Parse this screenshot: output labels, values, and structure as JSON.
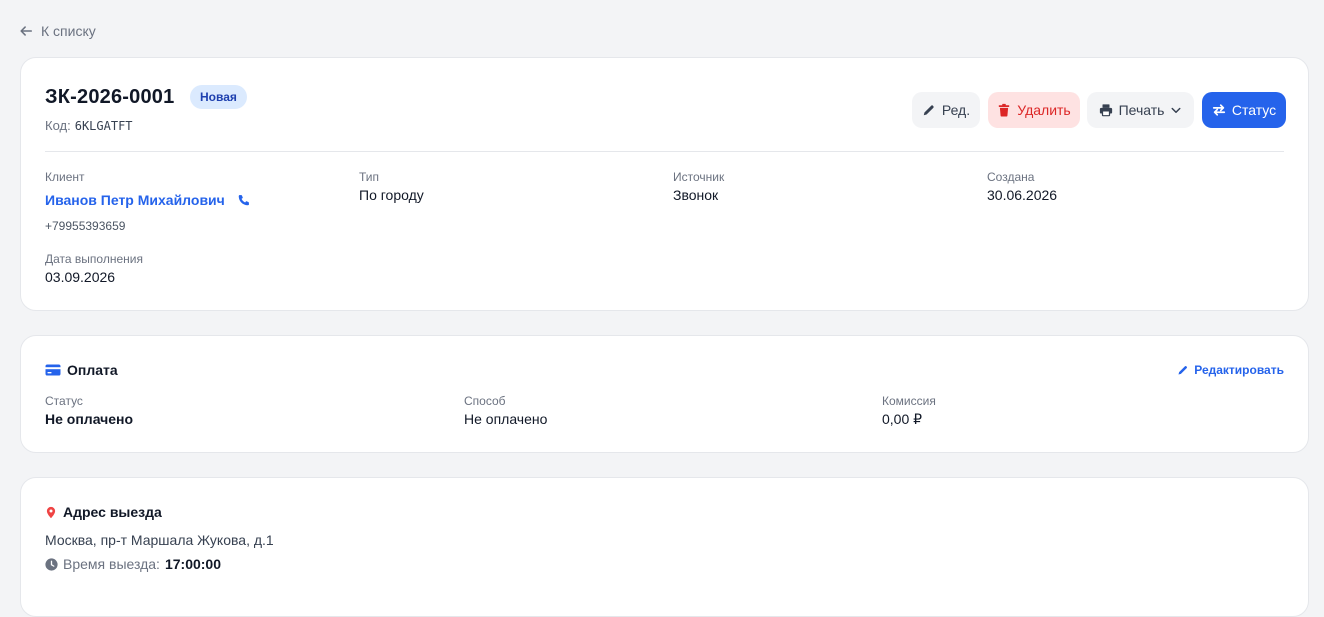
{
  "nav": {
    "back_label": "К списку"
  },
  "order": {
    "number": "ЗК-2026-0001",
    "status_badge": "Новая",
    "code_label": "Код:",
    "code_value": "6KLGATFT",
    "actions": {
      "edit": "Ред.",
      "delete": "Удалить",
      "print": "Печать",
      "status": "Статус"
    },
    "fields": {
      "client_label": "Клиент",
      "client_name": "Иванов Петр Михайлович",
      "client_phone": "+79955393659",
      "type_label": "Тип",
      "type_value": "По городу",
      "source_label": "Источник",
      "source_value": "Звонок",
      "created_label": "Создана",
      "created_value": "30.06.2026",
      "due_label": "Дата выполнения",
      "due_value": "03.09.2026"
    }
  },
  "payment": {
    "title": "Оплата",
    "edit_label": "Редактировать",
    "status_label": "Статус",
    "status_value": "Не оплачено",
    "method_label": "Способ",
    "method_value": "Не оплачено",
    "fee_label": "Комиссия",
    "fee_value": "0,00 ₽"
  },
  "address": {
    "title": "Адрес выезда",
    "value": "Москва, пр-т Маршала Жукова, д.1",
    "time_label": "Время выезда:",
    "time_value": "17:00:00"
  },
  "icons": {
    "back": "arrow-left-icon",
    "edit": "pencil-icon",
    "delete": "trash-icon",
    "print": "printer-icon",
    "print_caret": "chevron-down-icon",
    "status": "arrows-exchange-icon",
    "phone": "phone-icon",
    "payment": "credit-card-icon",
    "payment_edit": "pencil-icon",
    "address": "map-pin-icon",
    "time": "clock-icon"
  },
  "colors": {
    "accent": "#2563eb",
    "danger": "#dc2626",
    "danger_bg": "#fee2e2",
    "badge_bg": "#dbeafe",
    "badge_text": "#1e40af",
    "page_bg": "#f3f4f6"
  }
}
